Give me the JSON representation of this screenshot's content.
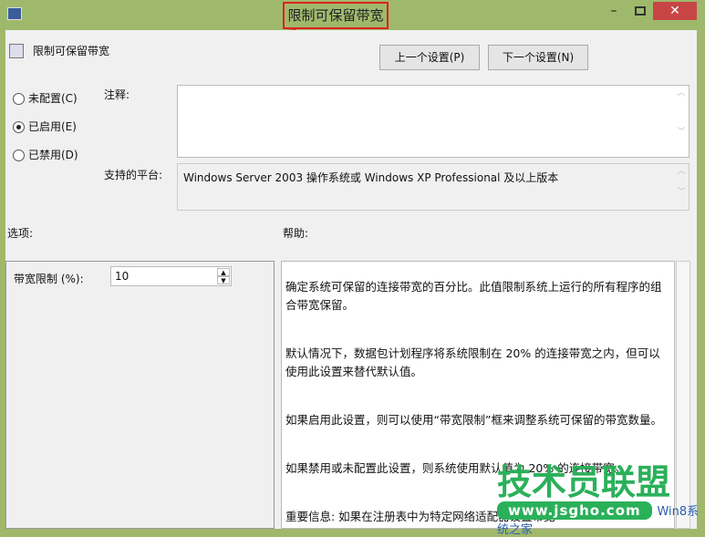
{
  "window": {
    "title": "限制可保留带宽",
    "heading": "限制可保留带宽"
  },
  "buttons": {
    "prev": "上一个设置(P)",
    "next": "下一个设置(N)"
  },
  "radios": [
    {
      "label": "未配置(C)",
      "checked": false
    },
    {
      "label": "已启用(E)",
      "checked": true
    },
    {
      "label": "已禁用(D)",
      "checked": false
    }
  ],
  "comment_label": "注释:",
  "comment_value": "",
  "platform_label": "支持的平台:",
  "platform_value": "Windows Server 2003 操作系统或 Windows XP Professional 及以上版本",
  "options_label": "选项:",
  "help_label": "帮助:",
  "bandwidth_label": "带宽限制 (%):",
  "bandwidth_value": "10",
  "help": [
    "确定系统可保留的连接带宽的百分比。此值限制系统上运行的所有程序的组合带宽保留。",
    "默认情况下，数据包计划程序将系统限制在 20% 的连接带宽之内，但可以使用此设置来替代默认值。",
    "如果启用此设置，则可以使用“带宽限制”框来调整系统可保留的带宽数量。",
    "如果禁用或未配置此设置，则系统使用默认值为 20% 的连接带宽。",
    "重要信息: 如果在注册表中为特定网络适配器设置带宽\n络适配器时就会忽略此设置。"
  ],
  "watermark": {
    "brand": "技术员联盟",
    "url": "www.jsgho.com",
    "sub": "Win8系统之家"
  }
}
